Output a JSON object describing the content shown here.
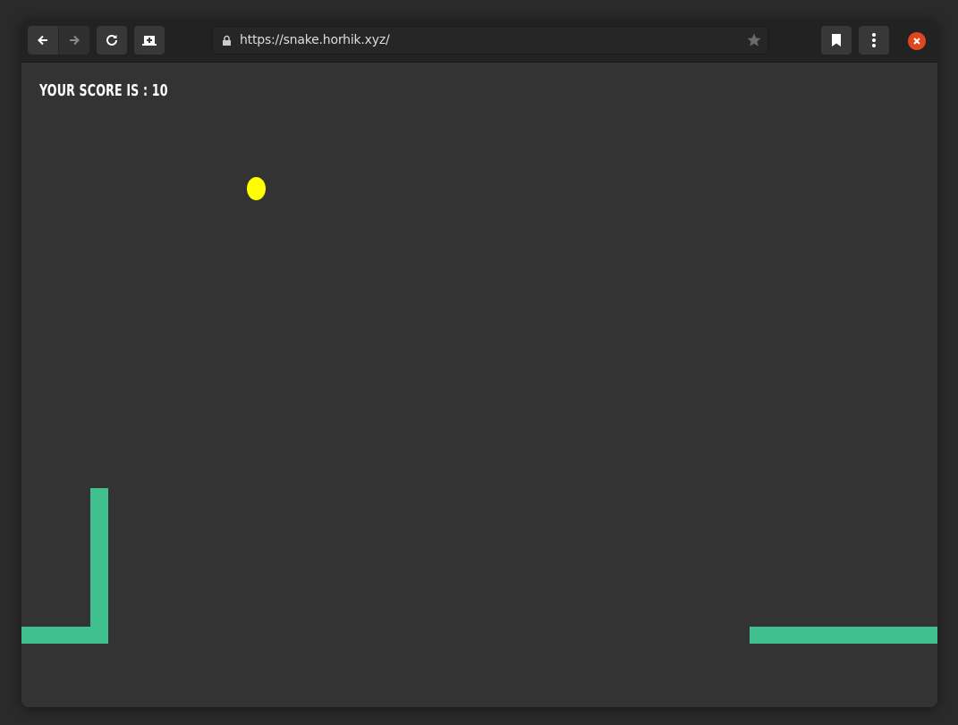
{
  "browser": {
    "url": "https://snake.horhik.xyz/",
    "buttons": {
      "back": "back",
      "forward": "forward",
      "reload": "reload",
      "screenshot": "take-screenshot",
      "bookmarks": "bookmarks",
      "menu": "menu",
      "close": "close"
    }
  },
  "game": {
    "score_label": "YOUR SCORE IS : ",
    "score_value": "10",
    "colors": {
      "background": "#333333",
      "snake": "#40bf8f",
      "food": "#ffff00",
      "close": "#e0471f"
    }
  }
}
